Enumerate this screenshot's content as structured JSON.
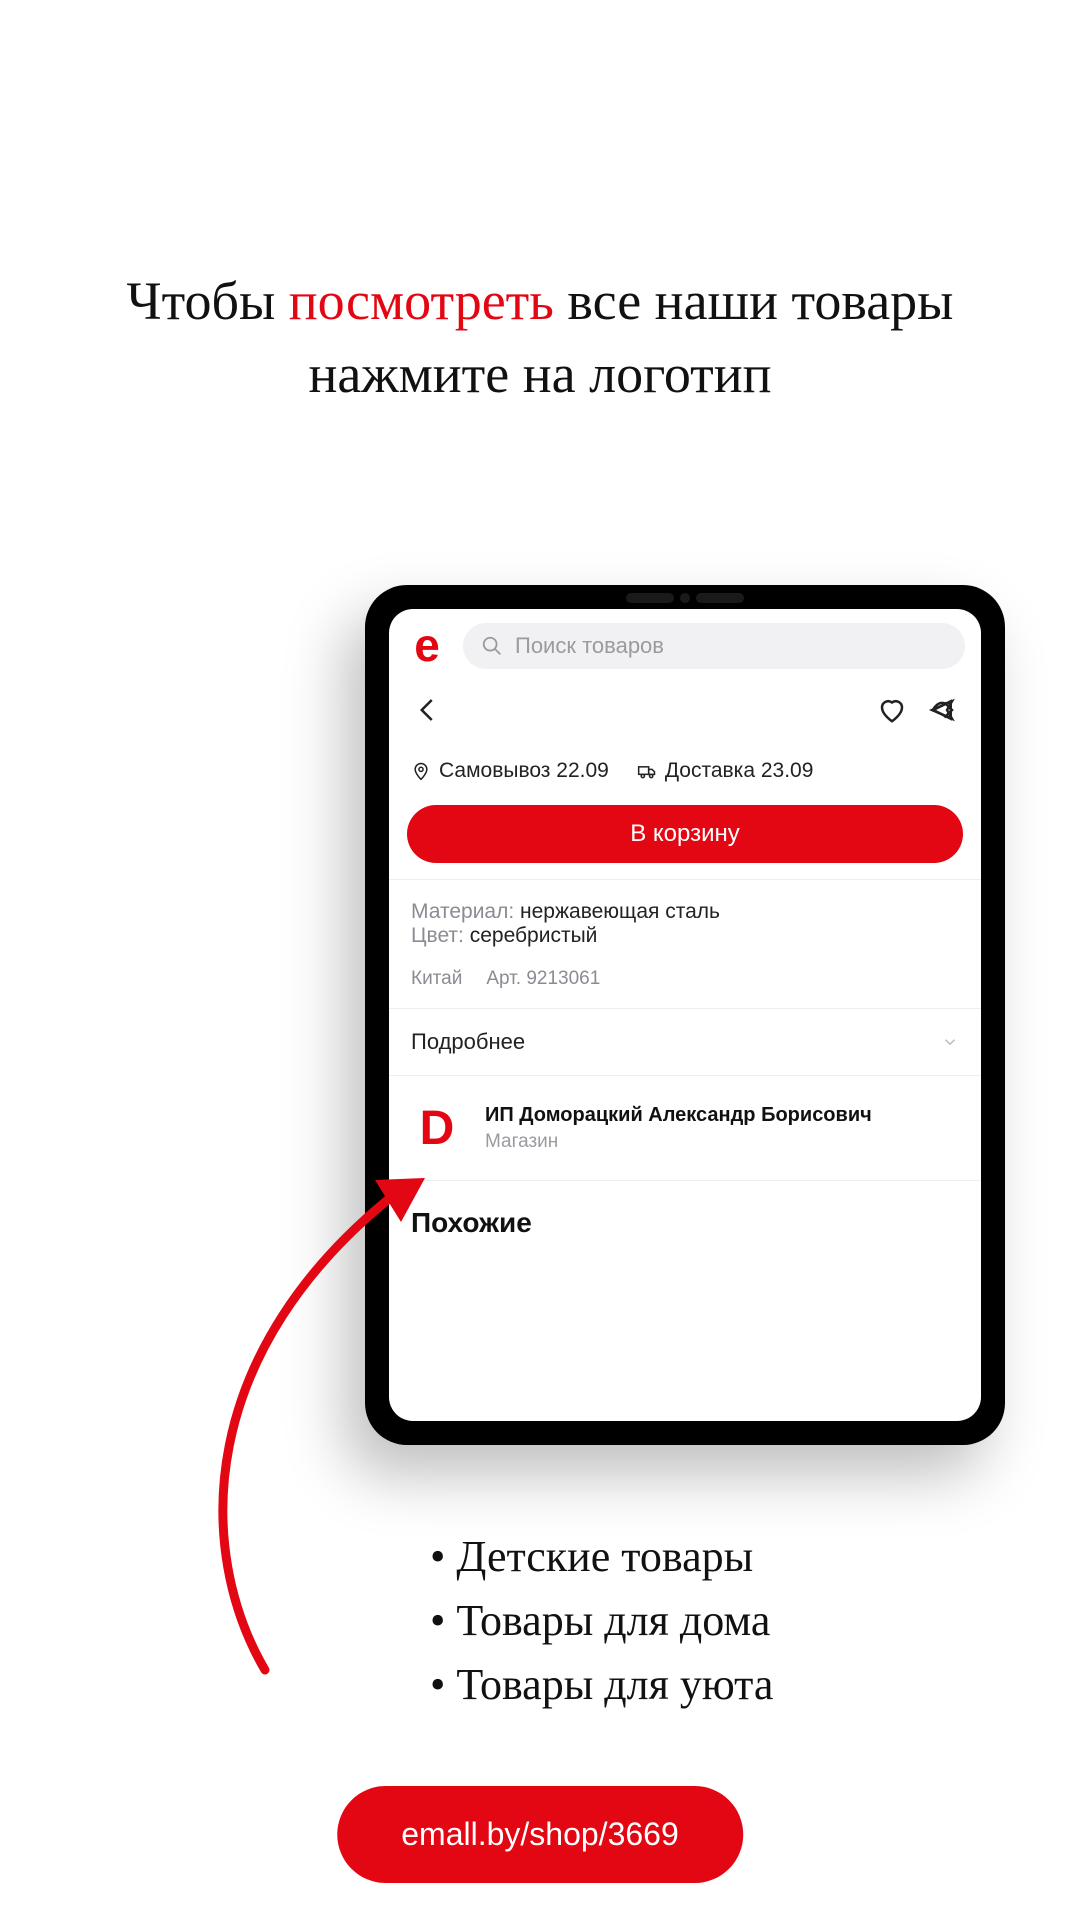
{
  "headline": {
    "part1": "Чтобы ",
    "highlight": "посмотреть",
    "part2": " все наши товары",
    "line2": "нажмите на логотип"
  },
  "tablet": {
    "search_placeholder": "Поиск товаров",
    "delivery": {
      "pickup": "Самовывоз 22.09",
      "shipping": "Доставка 23.09"
    },
    "cta": "В корзину",
    "specs": {
      "material_label": "Материал:",
      "material_value": " нержавеющая сталь",
      "color_label": "Цвет:",
      "color_value": " серебристый"
    },
    "meta": {
      "country": "Китай",
      "article": "Арт. 9213061"
    },
    "more": "Подробнее",
    "seller": {
      "logo_letter": "D",
      "name": "ИП Доморацкий Александр Борисович",
      "sub": "Магазин"
    },
    "similar": "Похожие"
  },
  "bullets": [
    "Детские товары",
    "Товары для дома",
    "Товары для уюта"
  ],
  "url": "emall.by/shop/3669",
  "colors": {
    "accent": "#e30613"
  }
}
